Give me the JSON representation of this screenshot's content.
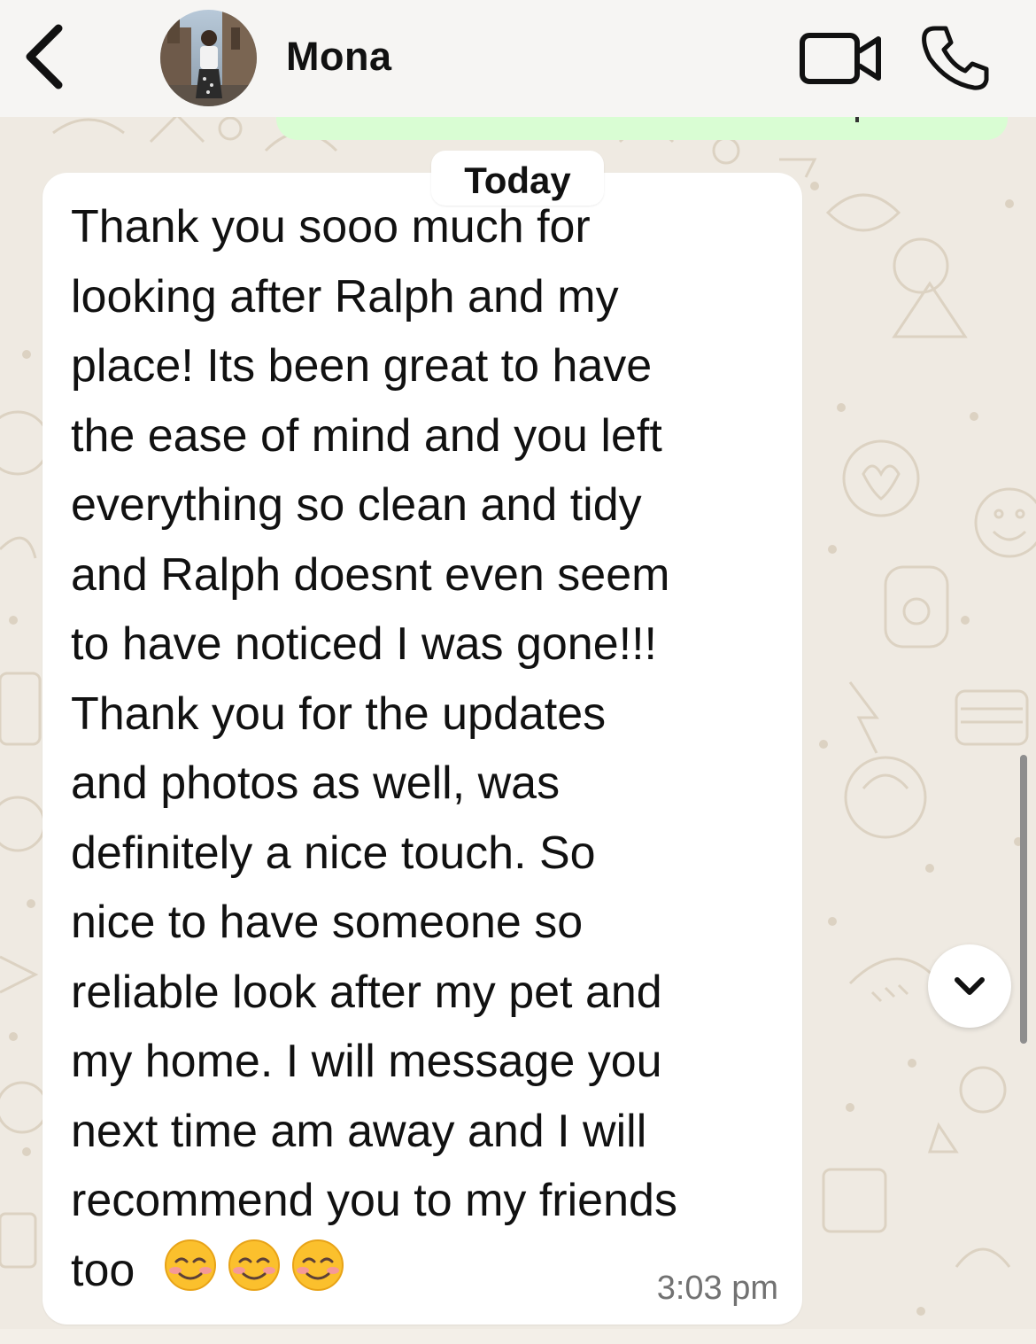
{
  "header": {
    "contact_name": "Mona"
  },
  "date_separator": "Today",
  "message": {
    "lines": [
      "Thank you sooo much for",
      "looking after Ralph and my",
      "place! Its been great to have",
      "the ease of mind and you left",
      "everything so clean and tidy",
      "and Ralph doesnt even seem",
      "to have noticed I was gone!!!",
      "Thank you for the updates",
      "and photos as well, was",
      "definitely a nice touch. So",
      "nice to have someone so",
      "reliable look after my pet and",
      "my home. I will message you",
      "next time am away and I will",
      "recommend you to my friends",
      "too"
    ],
    "emojis": [
      "☺️",
      "☺️",
      "☺️"
    ],
    "time": "3:03 pm"
  },
  "icons": {
    "back": "chevron-left-icon",
    "video": "video-camera-icon",
    "phone": "phone-icon",
    "scroll_down": "chevron-down-icon"
  },
  "colors": {
    "wallpaper": "#efeae2",
    "header": "#f6f5f3",
    "incoming_bubble": "#ffffff",
    "outgoing_bubble": "#d9fdd3",
    "timestamp": "#727272"
  }
}
